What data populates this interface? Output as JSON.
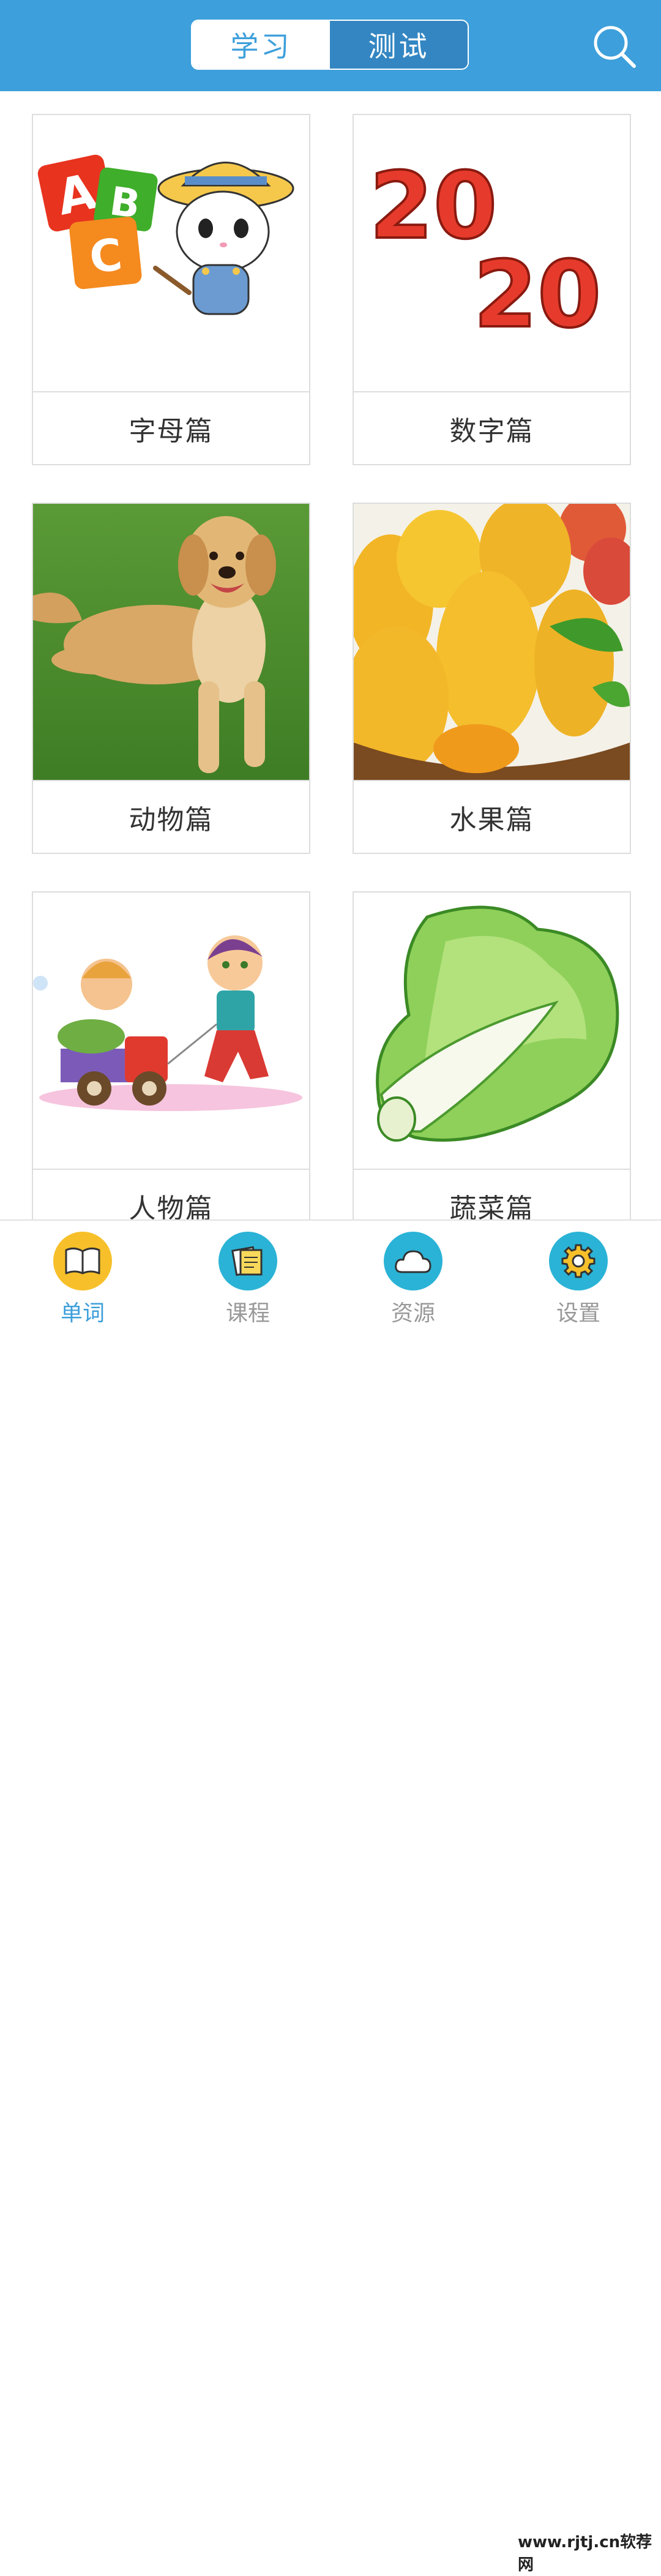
{
  "header": {
    "tabs": [
      {
        "label": "学习",
        "active": true
      },
      {
        "label": "测试",
        "active": false
      }
    ],
    "search_icon": "search-icon"
  },
  "categories": [
    {
      "label": "字母篇",
      "image": "abc-cat-illustration"
    },
    {
      "label": "数字篇",
      "image": "2020-balloon-numbers"
    },
    {
      "label": "动物篇",
      "image": "golden-retriever-on-grass"
    },
    {
      "label": "水果篇",
      "image": "mangoes-in-basket"
    },
    {
      "label": "人物篇",
      "image": "kids-with-toy-truck"
    },
    {
      "label": "蔬菜篇",
      "image": "chinese-cabbage"
    }
  ],
  "abc_letters": [
    "A",
    "B",
    "C"
  ],
  "number_art": [
    "20",
    "20"
  ],
  "tabbar": {
    "items": [
      {
        "label": "单词",
        "icon": "book-icon",
        "active": true
      },
      {
        "label": "课程",
        "icon": "notebook-icon",
        "active": false
      },
      {
        "label": "资源",
        "icon": "cloud-icon",
        "active": false
      },
      {
        "label": "设置",
        "icon": "gear-icon",
        "active": false
      }
    ]
  },
  "watermark": "www.rjtj.cn软荐网",
  "colors": {
    "header_bg": "#3d9fdb",
    "active_tab_circle": "#f7c02a",
    "inactive_tab_circle": "#2ab3d6",
    "active_label": "#3d9fdb",
    "inactive_label": "#999999"
  }
}
